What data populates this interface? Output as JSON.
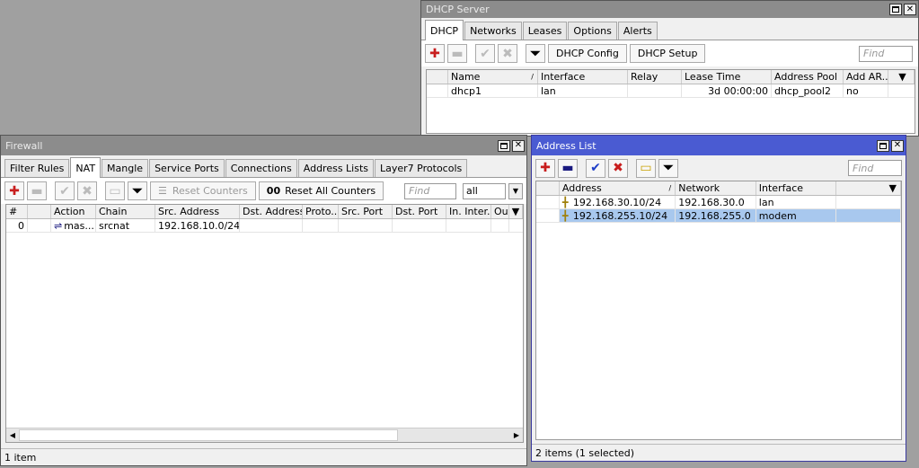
{
  "dhcp": {
    "title": "DHCP Server",
    "tabs": [
      "DHCP",
      "Networks",
      "Leases",
      "Options",
      "Alerts"
    ],
    "selected_tab": 0,
    "buttons": {
      "config": "DHCP Config",
      "setup": "DHCP Setup"
    },
    "find_placeholder": "Find",
    "columns": [
      "",
      "Name",
      "Interface",
      "Relay",
      "Lease Time",
      "Address Pool",
      "Add AR..."
    ],
    "rows": [
      [
        "",
        "dhcp1",
        "lan",
        "",
        "3d 00:00:00",
        "dhcp_pool2",
        "no"
      ]
    ]
  },
  "firewall": {
    "title": "Firewall",
    "tabs": [
      "Filter Rules",
      "NAT",
      "Mangle",
      "Service Ports",
      "Connections",
      "Address Lists",
      "Layer7 Protocols"
    ],
    "selected_tab": 1,
    "buttons": {
      "reset_counters": "Reset Counters",
      "reset_all_counters": "Reset All Counters",
      "reset_all_prefix": "00"
    },
    "find_placeholder": "Find",
    "filter_value": "all",
    "columns": [
      "#",
      "",
      "Action",
      "Chain",
      "Src. Address",
      "Dst. Address",
      "Proto...",
      "Src. Port",
      "Dst. Port",
      "In. Inter...",
      "Out"
    ],
    "rows": [
      [
        "0",
        "",
        "mas...",
        "srcnat",
        "192.168.10.0/24",
        "",
        "",
        "",
        "",
        "",
        ""
      ]
    ],
    "status": "1 item"
  },
  "address_list": {
    "title": "Address List",
    "find_placeholder": "Find",
    "columns": [
      "",
      "Address",
      "Network",
      "Interface"
    ],
    "rows": [
      [
        "",
        "192.168.30.10/24",
        "192.168.30.0",
        "lan"
      ],
      [
        "",
        "192.168.255.10/24",
        "192.168.255.0",
        "modem"
      ]
    ],
    "selected_row": 1,
    "status": "2 items (1 selected)"
  },
  "icons": {
    "add": "plus-icon",
    "remove": "minus-icon",
    "enable": "check-icon",
    "disable": "x-icon",
    "comment": "comment-icon",
    "filter": "filter-icon",
    "address": "address-icon",
    "masq": "masquerade-icon"
  },
  "colors": {
    "active_title": "#4a5bd2",
    "inactive_title": "#8c8c8c",
    "selected_row": "#a8c8ee",
    "add_red": "#c81e1e"
  }
}
